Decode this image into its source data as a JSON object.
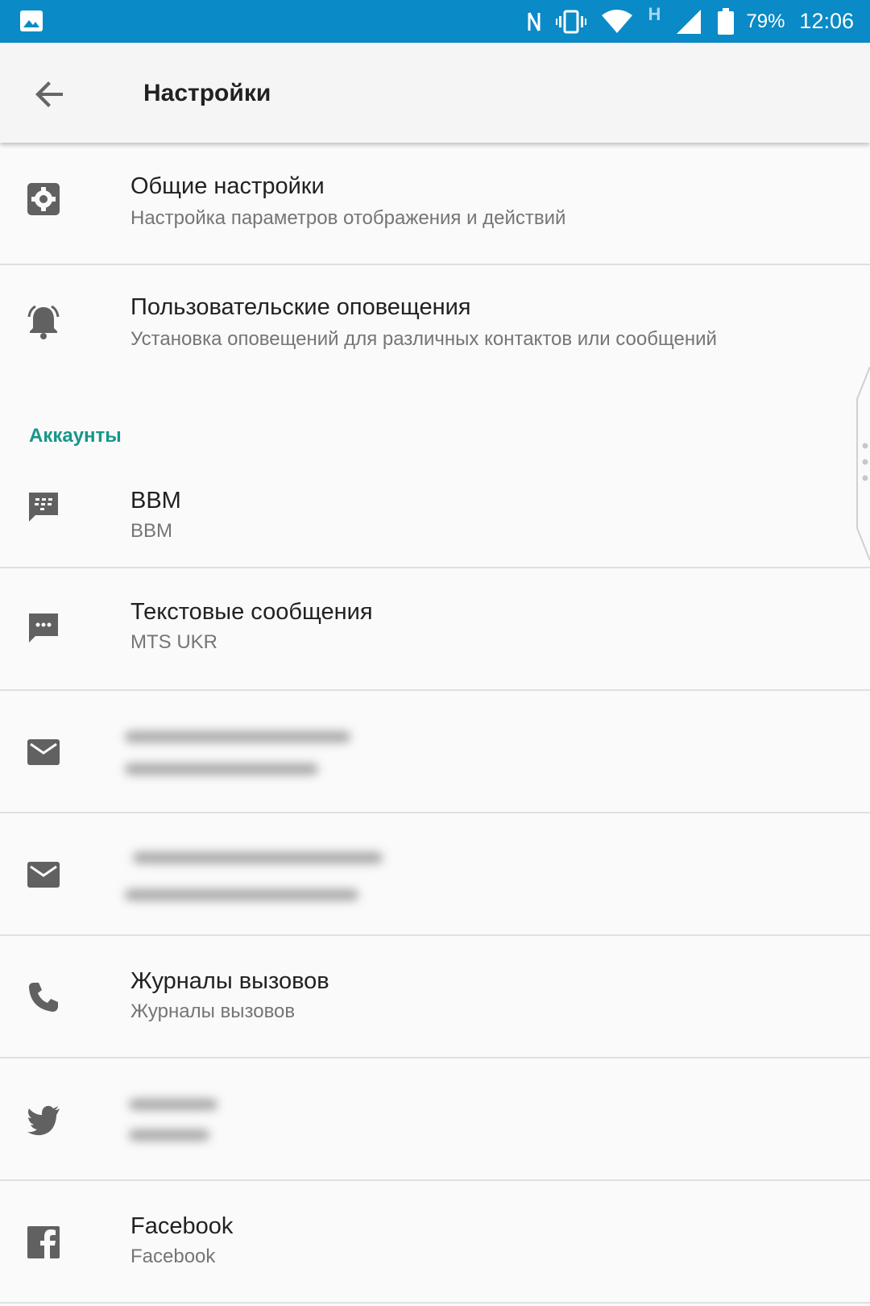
{
  "status_bar": {
    "battery_percent": "79%",
    "time": "12:06",
    "network_type": "H",
    "icons": [
      "gallery-icon",
      "nfc-icon",
      "vibrate-icon",
      "wifi-icon",
      "signal-icon",
      "battery-icon"
    ],
    "background_color": "#0a8ac7"
  },
  "app_bar": {
    "title": "Настройки",
    "back_icon": "arrow-back-icon"
  },
  "settings": [
    {
      "title": "Общие настройки",
      "subtitle": "Настройка параметров отображения и действий",
      "icon": "gear-icon"
    },
    {
      "title": "Пользовательские оповещения",
      "subtitle": "Установка оповещений для различных контактов или сообщений",
      "icon": "bell-icon"
    }
  ],
  "accounts_section": {
    "header": "Аккаунты",
    "header_color": "#17968a"
  },
  "accounts": [
    {
      "title": "BBM",
      "subtitle": "BBM",
      "icon": "bbm-icon"
    },
    {
      "title": "Текстовые сообщения",
      "subtitle": "MTS UKR",
      "icon": "sms-icon"
    },
    {
      "title": "",
      "subtitle": "",
      "icon": "mail-icon",
      "redacted": true
    },
    {
      "title": "",
      "subtitle": "",
      "icon": "mail-icon",
      "redacted": true
    },
    {
      "title": "Журналы вызовов",
      "subtitle": "Журналы вызовов",
      "icon": "phone-icon"
    },
    {
      "title": "",
      "subtitle": "",
      "icon": "twitter-icon",
      "redacted": true
    },
    {
      "title": "Facebook",
      "subtitle": "Facebook",
      "icon": "facebook-icon"
    }
  ]
}
